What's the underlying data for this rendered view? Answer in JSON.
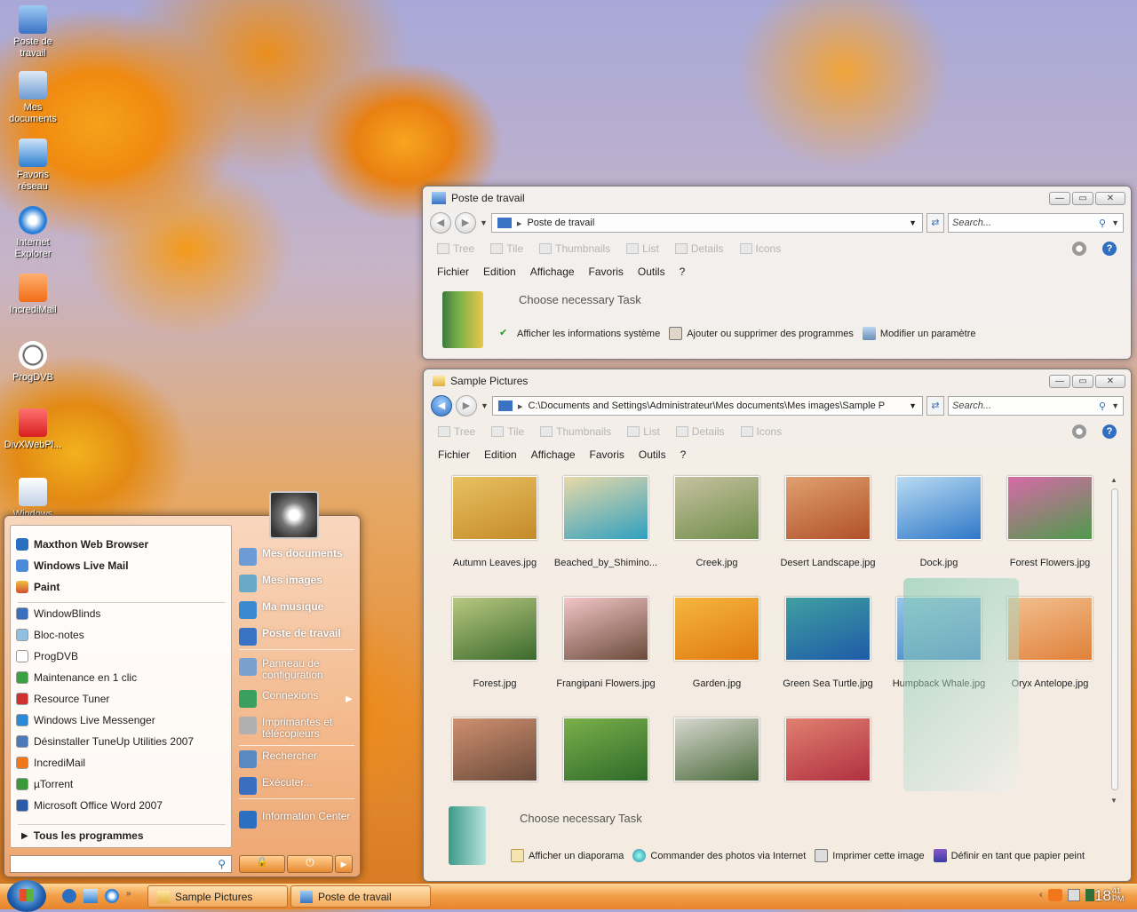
{
  "desktop": {
    "icons": [
      {
        "label_a": "Poste de",
        "label_b": "travail",
        "color": "#3a73c4"
      },
      {
        "label_a": "Mes",
        "label_b": "documents",
        "color": "#6c9bd5"
      },
      {
        "label_a": "Favoris",
        "label_b": "réseau",
        "color": "#2f80d0"
      },
      {
        "label_a": "Internet",
        "label_b": "Explorer",
        "color": "#2a7fd9"
      },
      {
        "label_a": "IncrediMail",
        "label_b": "",
        "color": "#f26d16"
      },
      {
        "label_a": "ProgDVB",
        "label_b": "",
        "color": "#ffffff"
      },
      {
        "label_a": "DivXWebPl...",
        "label_b": "",
        "color": "#d92020"
      },
      {
        "label_a": "Windows Live",
        "label_b": "",
        "color": "#e0e8f4"
      }
    ]
  },
  "window1": {
    "title": "Poste de travail",
    "address": "Poste de travail",
    "search_placeholder": "Search...",
    "views": [
      "Tree",
      "Tile",
      "Thumbnails",
      "List",
      "Details",
      "Icons"
    ],
    "menu": [
      "Fichier",
      "Edition",
      "Affichage",
      "Favoris",
      "Outils",
      "?"
    ],
    "task_heading": "Choose necessary Task",
    "tasks": [
      "Afficher les informations système",
      "Ajouter ou supprimer des programmes",
      "Modifier un paramètre"
    ]
  },
  "window2": {
    "title": "Sample Pictures",
    "address": "C:\\Documents and Settings\\Administrateur\\Mes documents\\Mes images\\Sample P",
    "search_placeholder": "Search...",
    "views": [
      "Tree",
      "Tile",
      "Thumbnails",
      "List",
      "Details",
      "Icons"
    ],
    "menu": [
      "Fichier",
      "Edition",
      "Affichage",
      "Favoris",
      "Outils",
      "?"
    ],
    "thumbnails": [
      {
        "name": "Autumn Leaves.jpg",
        "c1": "#c58a2a",
        "c2": "#e8c160"
      },
      {
        "name": "Beached_by_Shimino...",
        "c1": "#2fa0c0",
        "c2": "#e8d9a8"
      },
      {
        "name": "Creek.jpg",
        "c1": "#6f8d4a",
        "c2": "#c7c2a0"
      },
      {
        "name": "Desert Landscape.jpg",
        "c1": "#b0502a",
        "c2": "#e0a070"
      },
      {
        "name": "Dock.jpg",
        "c1": "#2f78c8",
        "c2": "#b9dbf2"
      },
      {
        "name": "Forest Flowers.jpg",
        "c1": "#4f9a4a",
        "c2": "#d66aa8"
      },
      {
        "name": "Forest.jpg",
        "c1": "#3b6a2c",
        "c2": "#b8c880"
      },
      {
        "name": "Frangipani Flowers.jpg",
        "c1": "#6a4a3a",
        "c2": "#f2c6c6"
      },
      {
        "name": "Garden.jpg",
        "c1": "#e07a10",
        "c2": "#f5b640"
      },
      {
        "name": "Green Sea Turtle.jpg",
        "c1": "#1f5aa8",
        "c2": "#3fa0a0"
      },
      {
        "name": "Humpback Whale.jpg",
        "c1": "#3a7ec0",
        "c2": "#9cc6e8"
      },
      {
        "name": "Oryx Antelope.jpg",
        "c1": "#e0803a",
        "c2": "#f2c090"
      },
      {
        "name": "",
        "c1": "#6a4a3a",
        "c2": "#d09070"
      },
      {
        "name": "",
        "c1": "#2f6a2a",
        "c2": "#7ab04a"
      },
      {
        "name": "",
        "c1": "#4a6a3a",
        "c2": "#d8d8d0"
      },
      {
        "name": "",
        "c1": "#b03040",
        "c2": "#e08070"
      }
    ],
    "task_heading": "Choose necessary Task",
    "tasks": [
      "Afficher un diaporama",
      "Commander des photos via Internet",
      "Imprimer cette image",
      "Définir en tant que papier peint"
    ]
  },
  "startmenu": {
    "pinned": [
      "Maxthon Web Browser",
      "Windows Live Mail",
      "Paint"
    ],
    "recent": [
      "WindowBlinds",
      "Bloc-notes",
      "ProgDVB",
      "Maintenance en 1 clic",
      "Resource Tuner",
      "Windows Live Messenger",
      "Désinstaller TuneUp Utilities 2007",
      "IncrediMail",
      "µTorrent",
      "Microsoft Office Word 2007"
    ],
    "all_programs": "Tous les programmes",
    "right": [
      {
        "label": "Mes documents",
        "bold": true
      },
      {
        "label": "Mes images",
        "bold": true
      },
      {
        "label": "Ma musique",
        "bold": true
      },
      {
        "label": "Poste de travail",
        "bold": true
      },
      {
        "label": "Panneau de configuration",
        "bold": false
      },
      {
        "label": "Connexions",
        "bold": false
      },
      {
        "label": "Imprimantes et télécopieurs",
        "bold": false
      },
      {
        "label": "Rechercher",
        "bold": false
      },
      {
        "label": "Exécuter...",
        "bold": false
      },
      {
        "label": "Information Center",
        "bold": false
      }
    ]
  },
  "taskbar": {
    "buttons": [
      "Sample Pictures",
      "Poste de travail"
    ],
    "clock_hour": "18",
    "clock_min": "41",
    "clock_ampm": "PM"
  }
}
